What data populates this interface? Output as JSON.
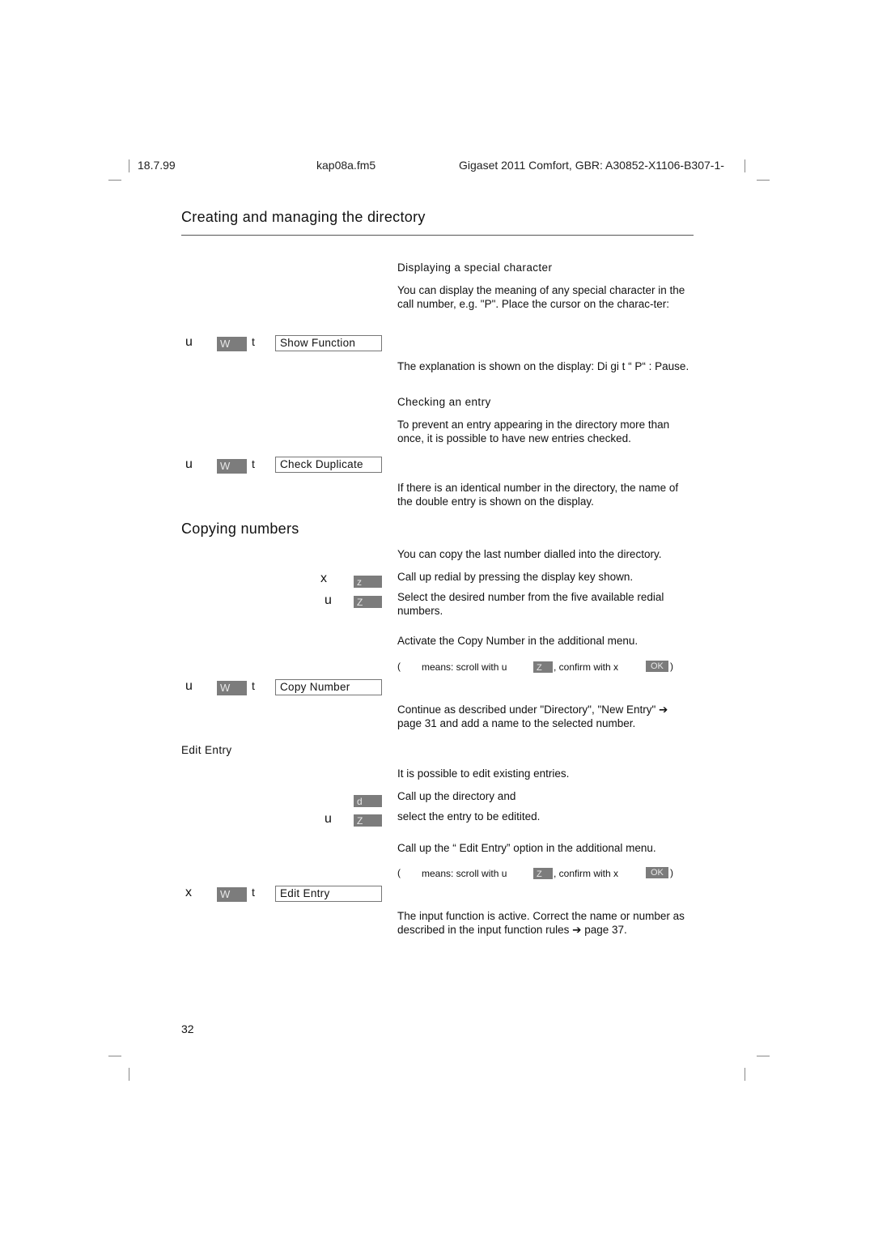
{
  "header": {
    "date": "18.7.99",
    "file": "kap08a.fm5",
    "product": "Gigaset 2011 Comfort, GBR: A30852-X1106-B307-1-"
  },
  "page_title": "Creating and managing the directory",
  "sections": {
    "special_char": {
      "heading": "Displaying a special character",
      "intro": "You can display the meaning of any special character in the call number, e.g. \"P\". Place the cursor on the charac-ter:",
      "step": {
        "nav": "u",
        "key": "W",
        "arrow": "t",
        "menu": "Show Function"
      },
      "result": "The explanation is shown on the display: Di gi t  “ P“ : Pause."
    },
    "check_entry": {
      "heading": "Checking an entry",
      "intro": "To prevent an entry appearing in the directory more than once, it is possible to have new entries checked.",
      "step": {
        "nav": "u",
        "key": "W",
        "arrow": "t",
        "menu": "Check Duplicate"
      },
      "result": "If there is an identical number in the directory, the name of the double entry is shown on the display."
    },
    "copying": {
      "heading": "Copying numbers",
      "intro": "You can copy the last number dialled into the directory.",
      "steps": [
        {
          "glyph": "x",
          "key": "z",
          "text": "Call up redial by pressing the display key shown."
        },
        {
          "glyph": "u",
          "key": "Z",
          "text": "Select the desired number from the five available redial numbers."
        }
      ],
      "activate": "Activate the Copy Number in the additional menu.",
      "hint": {
        "glyph": "(",
        "means": "means: scroll with u",
        "scroll_key": "Z",
        "confirm": ", confirm with x",
        "ok_key": "OK",
        "close": ")"
      },
      "menu_step": {
        "nav": "u",
        "key": "W",
        "arrow": "t",
        "menu": "Copy Number"
      },
      "result": "Continue as described under \"Directory\", \"New Entry\" ➔ page 31 and add a name to the selected number."
    },
    "edit_entry": {
      "heading": "Edit Entry",
      "intro": "It is possible to edit existing entries.",
      "steps": [
        {
          "glyph": "",
          "key": "d",
          "text": "Call up the directory and"
        },
        {
          "glyph": "u",
          "key": "Z",
          "text": "select the entry to be editited."
        }
      ],
      "activate": "Call up the “ Edit Entry”  option in the additional menu.",
      "hint": {
        "glyph": "(",
        "means": "means: scroll with u",
        "scroll_key": "Z",
        "confirm": ", confirm with x",
        "ok_key": "OK",
        "close": ")"
      },
      "menu_step": {
        "nav": "x",
        "key": "W",
        "arrow": "t",
        "menu": "Edit Entry"
      },
      "result": "The input function is active. Correct the name or number as described in the input function rules ➔ page 37."
    }
  },
  "footer": {
    "page_number": "32"
  }
}
